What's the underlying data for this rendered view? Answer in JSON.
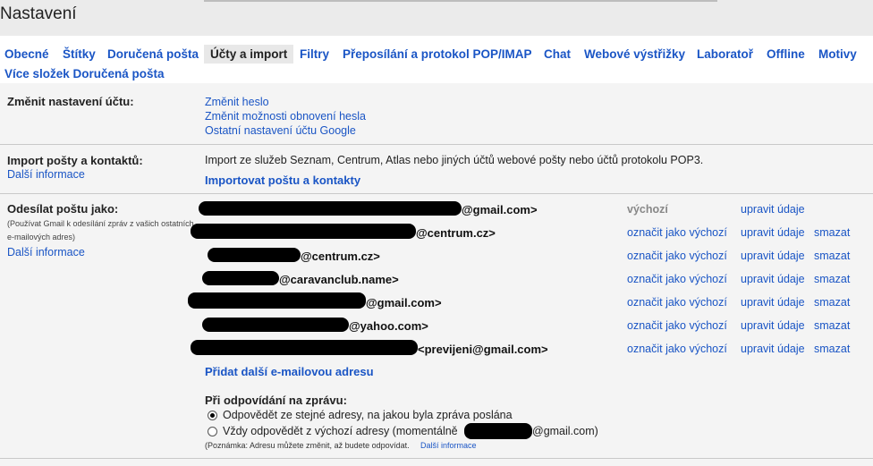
{
  "header": {
    "title": "Nastavení"
  },
  "tabs": [
    "Obecné",
    "Štítky",
    "Doručená pošta",
    "Účty a import",
    "Filtry",
    "Přeposílání a protokol POP/IMAP",
    "Chat",
    "Webové výstřižky",
    "Laboratoř",
    "Offline",
    "Motivy",
    "Více složek Doručená pošta"
  ],
  "account_settings": {
    "label": "Změnit nastavení účtu:",
    "links": [
      "Změnit heslo",
      "Změnit možnosti obnovení hesla",
      "Ostatní nastavení účtu Google"
    ]
  },
  "import": {
    "label": "Import pošty a kontaktů:",
    "more_info": "Další informace",
    "description": "Import ze služeb Seznam, Centrum, Atlas nebo jiných účtů webové pošty nebo účtů protokolu POP3.",
    "action": "Importovat poštu a kontakty"
  },
  "send_as": {
    "label": "Odesílat poštu jako:",
    "note": "(Používat Gmail k odesílání zpráv z vašich ostatních e-mailových adres)",
    "more_info": "Další informace",
    "default_label": "výchozí",
    "make_default": "označit jako výchozí",
    "edit": "upravit údaje",
    "delete": "smazat",
    "addresses": [
      "@gmail.com>",
      "@centrum.cz>",
      "@centrum.cz>",
      "@caravanclub.name>",
      "@gmail.com>",
      "@yahoo.com>",
      "<previjeni@gmail.com>"
    ],
    "add_address": "Přidat další e-mailovou adresu",
    "reply_heading": "Při odpovídání na zprávu:",
    "reply_same": "Odpovědět ze stejné adresy, na jakou byla zpráva poslána",
    "reply_default_prefix": "Vždy odpovědět z výchozí adresy (momentálně",
    "reply_default_suffix": "@gmail.com)",
    "footnote": "(Poznámka: Adresu můžete změnit, až budete odpovídat.",
    "footnote_link": "Další informace"
  }
}
